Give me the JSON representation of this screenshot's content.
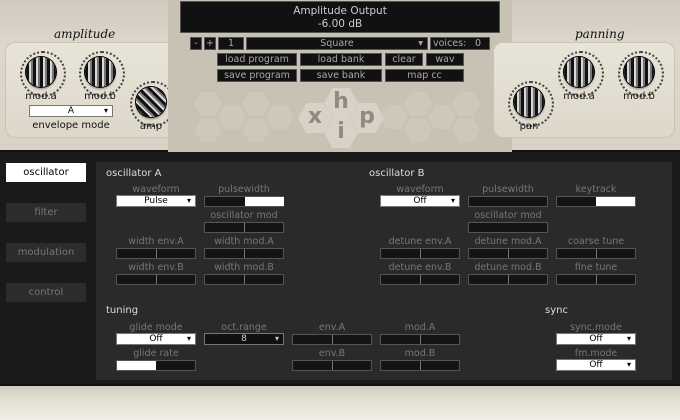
{
  "amplitude": {
    "title": "amplitude",
    "knobs": {
      "mod_a": "mod.a",
      "mod_b": "mod.b",
      "amp": "amp"
    },
    "envelope_mode_value": "A",
    "envelope_mode_label": "envelope mode"
  },
  "panning": {
    "title": "panning",
    "knobs": {
      "mod_a": "mod.a",
      "mod_b": "mod.b",
      "pan": "pan"
    }
  },
  "display": {
    "line1": "Amplitude Output",
    "line2": "-6.00 dB"
  },
  "toolbar": {
    "minus": "-",
    "plus": "+",
    "program_number": "1",
    "program_name": "Square",
    "voices_label": "voices:",
    "voices_value": "0",
    "load_program": "load program",
    "load_bank": "load bank",
    "clear": "clear",
    "wav": "wav",
    "save_program": "save program",
    "save_bank": "save bank",
    "map_cc": "map cc"
  },
  "logo": {
    "x": "x",
    "h": "h",
    "i": "i",
    "p": "p"
  },
  "nav": {
    "items": [
      "oscillator",
      "filter",
      "modulation",
      "control"
    ],
    "active": "oscillator"
  },
  "osc_a": {
    "title": "oscillator A",
    "waveform_label": "waveform",
    "waveform_value": "Pulse",
    "pulsewidth_label": "pulsewidth",
    "pulsewidth_fill": 0.5,
    "oscillator_mod_label": "oscillator mod",
    "width_env_a": "width env.A",
    "width_mod_a": "width mod.A",
    "width_env_b": "width env.B",
    "width_mod_b": "width mod.B"
  },
  "osc_b": {
    "title": "oscillator B",
    "waveform_label": "waveform",
    "waveform_value": "Off",
    "pulsewidth_label": "pulsewidth",
    "keytrack_label": "keytrack",
    "keytrack_fill": 0.5,
    "oscillator_mod_label": "oscillator mod",
    "detune_env_a": "detune env.A",
    "detune_mod_a": "detune mod.A",
    "coarse_tune": "coarse tune",
    "detune_env_b": "detune env.B",
    "detune_mod_b": "detune mod.B",
    "fine_tune": "fine tune"
  },
  "tuning": {
    "title": "tuning",
    "glide_mode_label": "glide mode",
    "glide_mode_value": "Off",
    "oct_range_label": "oct.range",
    "oct_range_value": "8",
    "env_a": "env.A",
    "mod_a": "mod.A",
    "glide_rate_label": "glide rate",
    "glide_rate_fill": 0.5,
    "env_b": "env.B",
    "mod_b": "mod.B"
  },
  "sync": {
    "title": "sync",
    "sync_mode_label": "sync.mode",
    "sync_mode_value": "Off",
    "fm_mode_label": "fm.mode",
    "fm_mode_value": "Off"
  }
}
